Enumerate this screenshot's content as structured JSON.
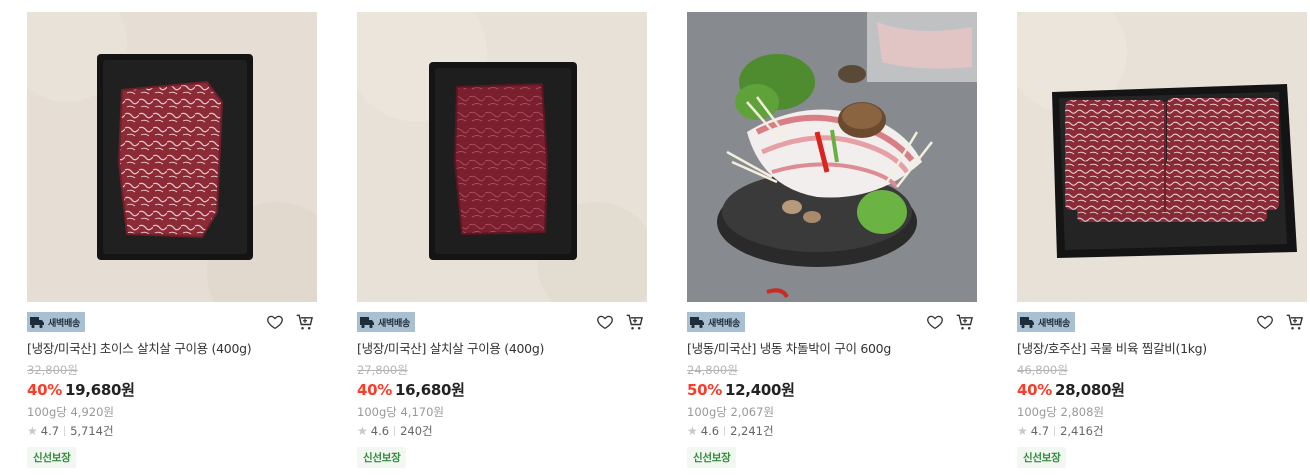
{
  "products": [
    {
      "delivery_badge": "새벽배송",
      "title": "[냉장/미국산] 초이스 살치살 구이용 (400g)",
      "original_price": "32,800원",
      "discount": "40%",
      "price": "19,680원",
      "unit_price": "100g당 4,920원",
      "rating": "4.7",
      "review_count": "5,714건",
      "tag": "신선보장",
      "image": "vacuum-packed-marbled-beef"
    },
    {
      "delivery_badge": "새벽배송",
      "title": "[냉장/미국산] 살치살 구이용 (400g)",
      "original_price": "27,800원",
      "discount": "40%",
      "price": "16,680원",
      "unit_price": "100g당 4,170원",
      "rating": "4.6",
      "review_count": "240건",
      "tag": "신선보장",
      "image": "vacuum-packed-red-beef"
    },
    {
      "delivery_badge": "새벽배송",
      "title": "[냉동/미국산] 냉동 차돌박이 구이 600g",
      "original_price": "24,800원",
      "discount": "50%",
      "price": "12,400원",
      "unit_price": "100g당 2,067원",
      "rating": "4.6",
      "review_count": "2,241건",
      "tag": "신선보장",
      "image": "beef-brisket-hotpot"
    },
    {
      "delivery_badge": "새벽배송",
      "title": "[냉장/호주산] 곡물 비육 찜갈비(1kg)",
      "original_price": "46,800원",
      "discount": "40%",
      "price": "28,080원",
      "unit_price": "100g당 2,808원",
      "rating": "4.7",
      "review_count": "2,416건",
      "tag": "신선보장",
      "image": "vacuum-packed-short-ribs"
    }
  ],
  "icons": {
    "wishlist": "heart-icon",
    "cart": "cart-icon",
    "delivery": "truck-icon",
    "rating": "star-icon"
  },
  "colors": {
    "discount": "#fa3c2a",
    "badge_bg": "#a9bfd2",
    "tag_text": "#2f8a3a",
    "tag_bg": "#f2f7f2",
    "star": "#c8c8c8"
  }
}
